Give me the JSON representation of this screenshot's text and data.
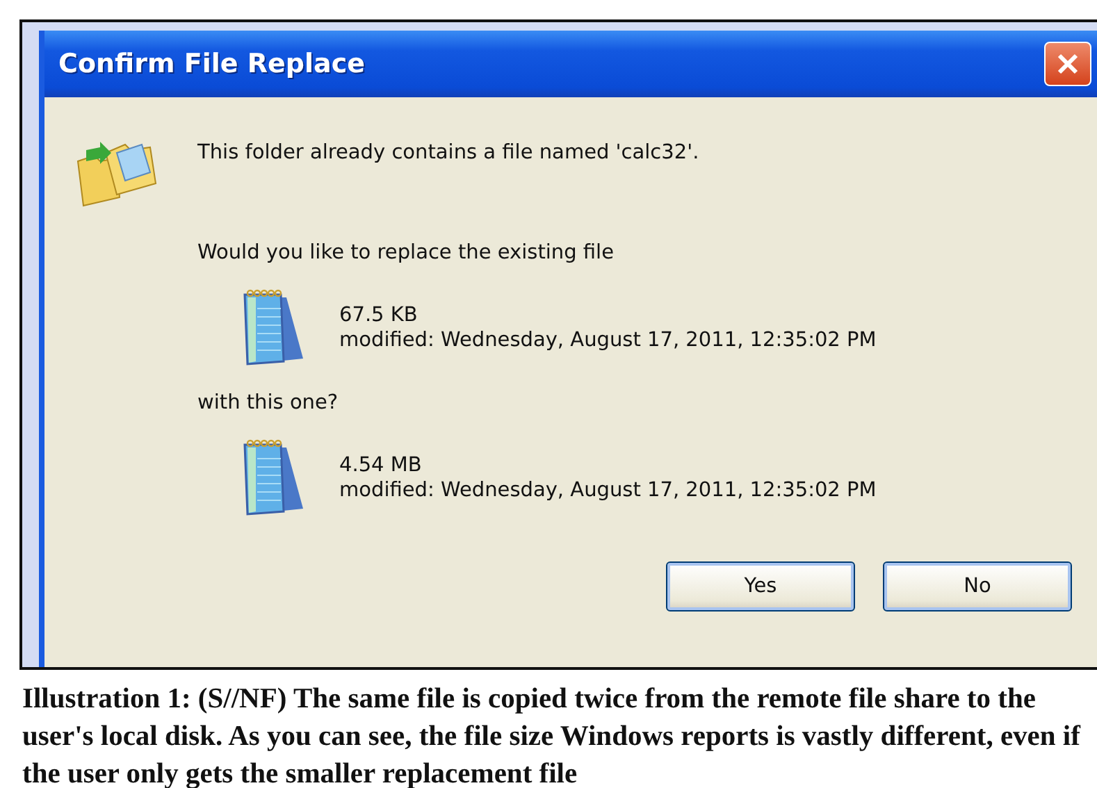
{
  "dialog": {
    "title": "Confirm File Replace",
    "message": "This folder already contains a file named 'calc32'.",
    "question": "Would you like to replace the existing file",
    "files": [
      {
        "size": "67.5 KB",
        "modified": "modified: Wednesday, August 17, 2011, 12:35:02 PM"
      },
      {
        "size": "4.54 MB",
        "modified": "modified: Wednesday, August 17, 2011, 12:35:02 PM"
      }
    ],
    "connector": "with this one?",
    "buttons": [
      "Yes",
      "No"
    ]
  },
  "caption": "Illustration 1: (S//NF) The same file is copied twice from the remote file share to the user's local disk.  As you can see, the file size Windows reports is vastly different, even if the user only gets the smaller replacement file"
}
